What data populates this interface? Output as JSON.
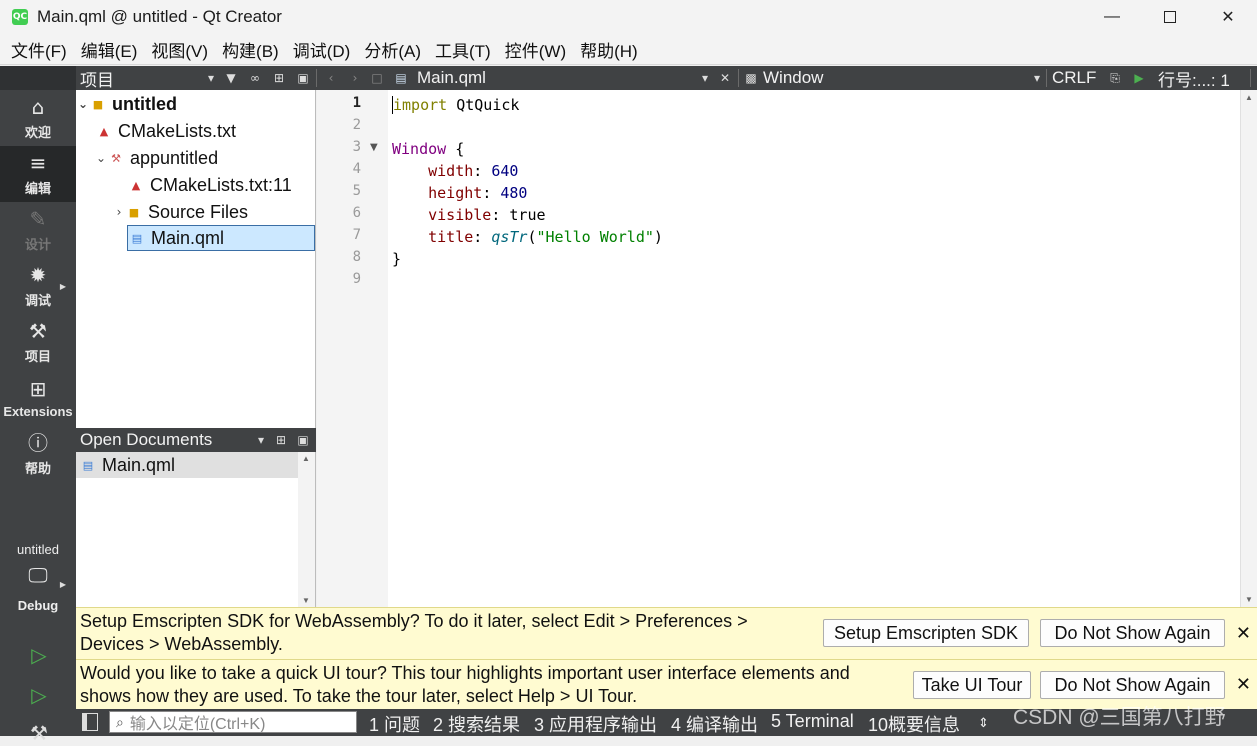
{
  "window": {
    "title": "Main.qml @ untitled - Qt Creator",
    "logo_text": "QC"
  },
  "menu": [
    "文件(F)",
    "编辑(E)",
    "视图(V)",
    "构建(B)",
    "调试(D)",
    "分析(A)",
    "工具(T)",
    "控件(W)",
    "帮助(H)"
  ],
  "modes": [
    {
      "label": "欢迎",
      "icon": "home-icon"
    },
    {
      "label": "编辑",
      "icon": "edit-icon"
    },
    {
      "label": "设计",
      "icon": "design-icon"
    },
    {
      "label": "调试",
      "icon": "debug-icon"
    },
    {
      "label": "项目",
      "icon": "wrench-icon"
    },
    {
      "label": "Extensions",
      "icon": "extensions-icon"
    },
    {
      "label": "帮助",
      "icon": "help-icon"
    }
  ],
  "kit": {
    "project": "untitled",
    "config": "Debug"
  },
  "project_pane": {
    "title": "项目",
    "tree": [
      {
        "label": "untitled"
      },
      {
        "label": "CMakeLists.txt"
      },
      {
        "label": "appuntitled"
      },
      {
        "label": "CMakeLists.txt:11"
      },
      {
        "label": "Source Files"
      },
      {
        "label": "Main.qml"
      }
    ]
  },
  "open_documents": {
    "title": "Open Documents",
    "items": [
      "Main.qml"
    ]
  },
  "editor_toolbar": {
    "file": "Main.qml",
    "symbol": "Window",
    "line_ending": "CRLF",
    "position": "行号:...: 1"
  },
  "editor": {
    "line_numbers": [
      "1",
      "2",
      "3",
      "4",
      "5",
      "6",
      "7",
      "8",
      "9"
    ],
    "code": {
      "l1_kw": "import",
      "l1_rest": " QtQuick",
      "l3_type": "Window",
      "l3_rest": " {",
      "l4_prop": "width",
      "l4_val": "640",
      "l5_prop": "height",
      "l5_val": "480",
      "l6_prop": "visible",
      "l6_val": "true",
      "l7_prop": "title",
      "l7_fn": "qsTr",
      "l7_str": "\"Hello World\"",
      "l8": "}"
    }
  },
  "infobars": [
    {
      "text": "Setup Emscripten SDK for WebAssembly? To do it later, select Edit > Preferences > Devices > WebAssembly.",
      "btn1": "Setup Emscripten SDK",
      "btn2": "Do Not Show Again"
    },
    {
      "text": "Would you like to take a quick UI tour? This tour highlights important user interface elements and shows how they are used. To take the tour later, select Help > UI Tour.",
      "btn1": "Take UI Tour",
      "btn2": "Do Not Show Again"
    }
  ],
  "statusbar": {
    "locator_placeholder": "输入以定位(Ctrl+K)",
    "tabs": [
      "1 问题",
      "2 搜索结果",
      "3 应用程序输出",
      "4 编译输出",
      "5 Terminal",
      "10概要信息"
    ]
  },
  "watermark": "CSDN @三国第八打野"
}
